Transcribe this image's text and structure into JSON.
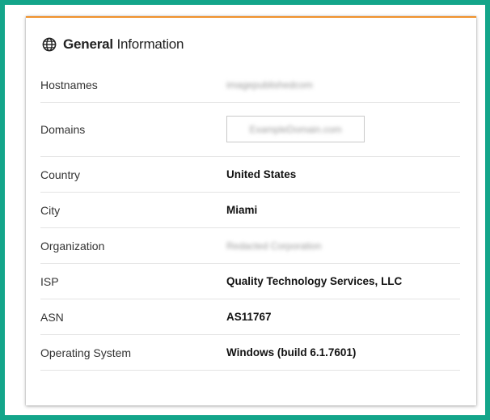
{
  "panel": {
    "title_bold": "General",
    "title_rest": " Information",
    "icon": "globe-icon",
    "accent_color": "#f0922c",
    "frame_color": "#13a58a"
  },
  "rows": [
    {
      "label": "Hostnames",
      "value": "imagepublishedcom",
      "redacted": true
    },
    {
      "label": "Domains",
      "value": "ExampleDomain.com",
      "redacted": true
    },
    {
      "label": "Country",
      "value": "United States"
    },
    {
      "label": "City",
      "value": "Miami"
    },
    {
      "label": "Organization",
      "value": "Redacted Corporation",
      "redacted": true
    },
    {
      "label": "ISP",
      "value": "Quality Technology Services, LLC"
    },
    {
      "label": "ASN",
      "value": "AS11767"
    },
    {
      "label": "Operating System",
      "value": "Windows (build 6.1.7601)"
    }
  ]
}
